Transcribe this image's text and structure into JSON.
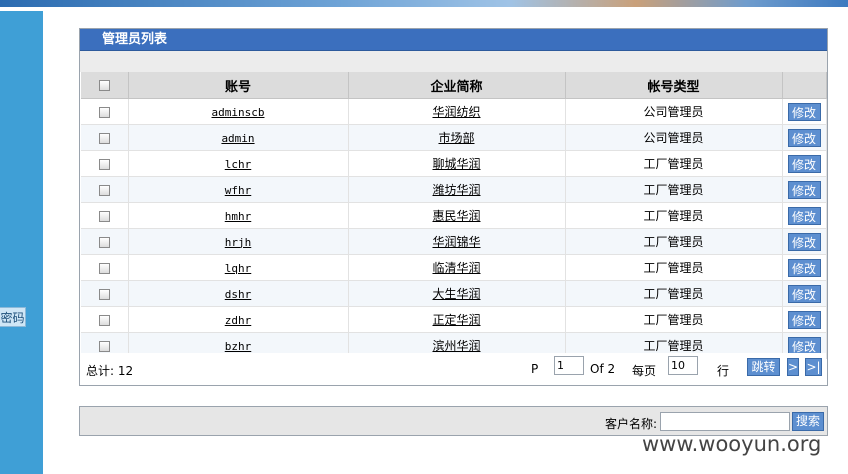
{
  "sidebar": {
    "item_label": "密码"
  },
  "panel": {
    "title": "管理员列表",
    "columns": [
      "账号",
      "企业简称",
      "帐号类型"
    ],
    "rows": [
      {
        "account": "adminscb",
        "enterprise": "华润纺织",
        "type": "公司管理员",
        "action": "修改"
      },
      {
        "account": "admin",
        "enterprise": "市场部",
        "type": "公司管理员",
        "action": "修改"
      },
      {
        "account": "lchr",
        "enterprise": "聊城华润",
        "type": "工厂管理员",
        "action": "修改"
      },
      {
        "account": "wfhr",
        "enterprise": "潍坊华润",
        "type": "工厂管理员",
        "action": "修改"
      },
      {
        "account": "hmhr",
        "enterprise": "惠民华润",
        "type": "工厂管理员",
        "action": "修改"
      },
      {
        "account": "hrjh",
        "enterprise": "华润锦华",
        "type": "工厂管理员",
        "action": "修改"
      },
      {
        "account": "lqhr",
        "enterprise": "临清华润",
        "type": "工厂管理员",
        "action": "修改"
      },
      {
        "account": "dshr",
        "enterprise": "大生华润",
        "type": "工厂管理员",
        "action": "修改"
      },
      {
        "account": "zdhr",
        "enterprise": "正定华润",
        "type": "工厂管理员",
        "action": "修改"
      },
      {
        "account": "bzhr",
        "enterprise": "滨州华润",
        "type": "工厂管理员",
        "action": "修改"
      }
    ],
    "footer": {
      "total_label": "总计: 12",
      "page_prefix": "P",
      "page_value": "1",
      "of_label": "Of 2",
      "per_page_label": "每页",
      "per_page_value": "10",
      "rows_label": "行",
      "jump_label": "跳转",
      "next_label": ">",
      "last_label": ">|"
    }
  },
  "search": {
    "label": "客户名称:",
    "value": "",
    "button_label": "搜索"
  },
  "watermark": "www.wooyun.org"
}
